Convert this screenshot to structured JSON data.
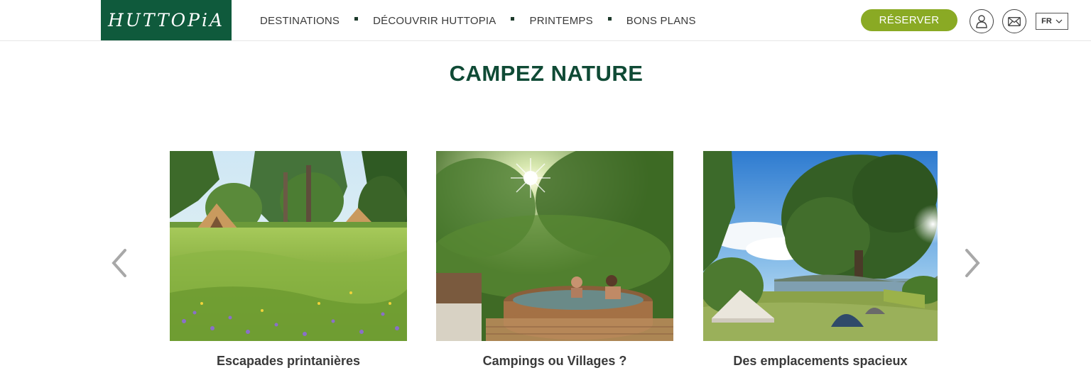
{
  "header": {
    "logo_text": "HUTTOPiA",
    "nav": [
      {
        "label": "DESTINATIONS"
      },
      {
        "label": "DÉCOUVRIR HUTTOPIA"
      },
      {
        "label": "PRINTEMPS"
      },
      {
        "label": "BONS PLANS"
      }
    ],
    "reserve_label": "RÉSERVER",
    "user_icon": "user-icon",
    "mail_icon": "mail-icon",
    "language": "FR",
    "language_icon": "chevron-down-icon"
  },
  "main": {
    "title": "CAMPEZ NATURE",
    "prev_icon": "chevron-left-icon",
    "next_icon": "chevron-right-icon",
    "cards": [
      {
        "caption": "Escapades printanières"
      },
      {
        "caption": "Campings ou Villages ?"
      },
      {
        "caption": "Des emplacements spacieux"
      }
    ]
  },
  "colors": {
    "brand_green": "#0f5a3c",
    "title_green": "#0f4a35",
    "button_green": "#8aaa24"
  }
}
